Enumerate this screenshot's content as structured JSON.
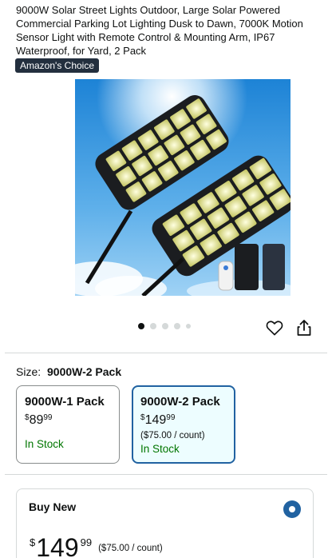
{
  "product": {
    "title": "9000W Solar Street Lights Outdoor, Large Solar Powered Commercial Parking Lot Lighting Dusk to Dawn, 7000K Motion Sensor Light with Remote Control & Mounting Arm, IP67 Waterproof, for Yard, 2 Pack",
    "badge": "Amazon's Choice"
  },
  "gallery": {
    "image_count": 5,
    "active_index": 0,
    "icons": {
      "save": "heart-icon",
      "share": "share-icon"
    }
  },
  "size": {
    "label": "Size:",
    "selected": "9000W-2 Pack",
    "options": [
      {
        "name": "9000W-1 Pack",
        "currency": "$",
        "whole": "89",
        "cents": "99",
        "unit_price": "",
        "stock": "In Stock",
        "selected": false
      },
      {
        "name": "9000W-2 Pack",
        "currency": "$",
        "whole": "149",
        "cents": "99",
        "unit_price": "($75.00 / count)",
        "stock": "In Stock",
        "selected": true
      }
    ]
  },
  "buy_box": {
    "title": "Buy New",
    "currency": "$",
    "whole": "149",
    "cents": "99",
    "unit_price": "($75.00 / count)"
  },
  "colors": {
    "accent_blue": "#2162a1",
    "selected_bg": "#edfdff",
    "in_stock_green": "#007600",
    "badge_bg": "#232f3e"
  }
}
